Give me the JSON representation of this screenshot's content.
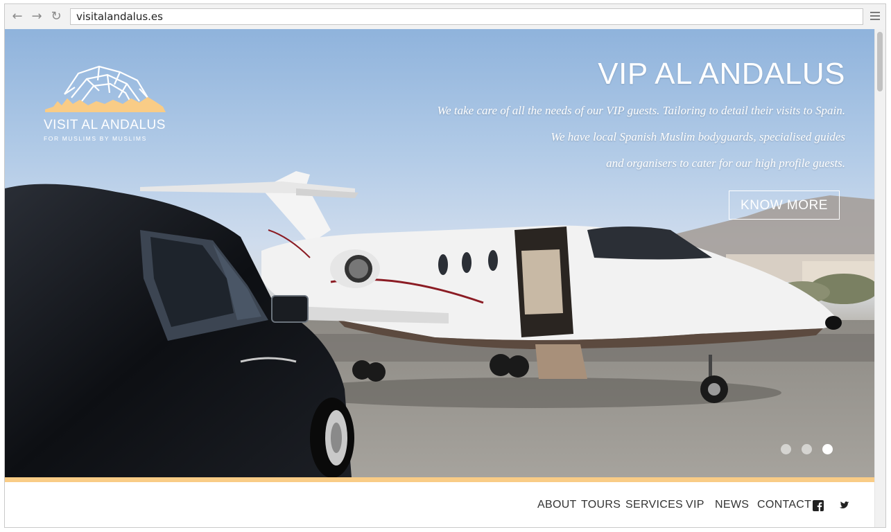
{
  "browser": {
    "url": "visitalandalus.es",
    "back_icon": "←",
    "forward_icon": "→",
    "reload_icon": "↻"
  },
  "logo": {
    "title": "VISIT AL ANDALUS",
    "subtitle": "FOR MUSLIMS BY MUSLIMS",
    "accent_color": "#f9cc86"
  },
  "hero": {
    "title": "VIP AL ANDALUS",
    "lines": [
      "We take care of  all the needs of  our VIP guests. Tailoring to detail their visits to Spain.",
      "We have local Spanish Muslim bodyguards, specialised guides",
      "and organisers to cater for our high profile guests."
    ],
    "cta_label": "KNOW MORE",
    "slides_total": 3,
    "slide_active": 3
  },
  "nav": {
    "items": [
      "ABOUT",
      "TOURS",
      "SERVICES",
      "VIP",
      "NEWS",
      "CONTACT"
    ],
    "social": [
      "facebook-icon",
      "twitter-icon"
    ]
  },
  "colors": {
    "accent": "#f9cc86",
    "text": "#333333"
  }
}
